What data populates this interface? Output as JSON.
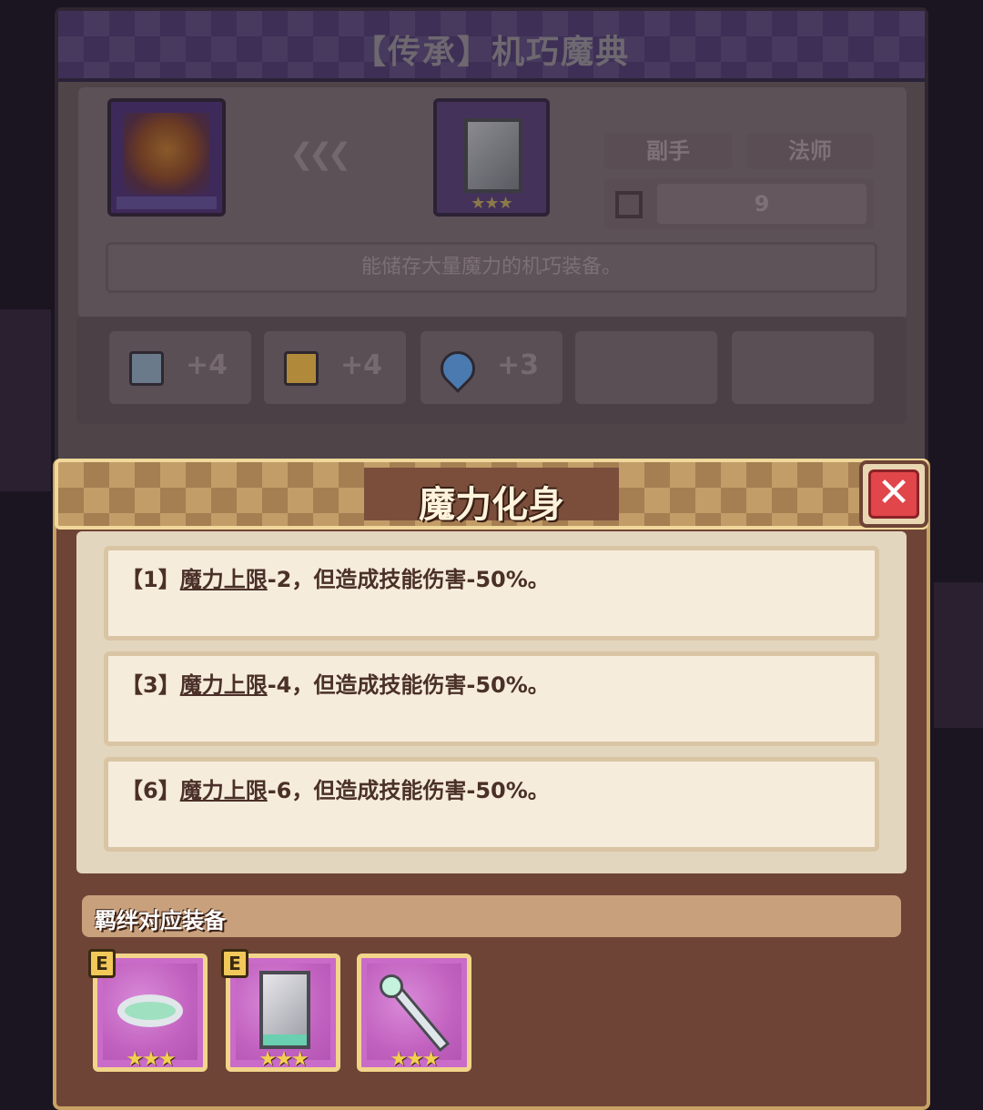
{
  "item_panel": {
    "title": "【传承】机巧魔典",
    "tag_slot": "副手",
    "tag_class": "法师",
    "level": "9",
    "description": "能储存大量魔力的机巧装备。",
    "item_stars": "★★★",
    "stats": [
      {
        "icon": "book-icon",
        "value": "+4"
      },
      {
        "icon": "boot-icon",
        "value": "+4"
      },
      {
        "icon": "mana-drop-icon",
        "value": "+3"
      }
    ]
  },
  "bond_panel": {
    "title": "魔力化身",
    "close_label": "✕",
    "effects": [
      {
        "prefix": "【1】",
        "keyword": "魔力上限",
        "suffix": "-2，但造成技能伤害-50%。"
      },
      {
        "prefix": "【3】",
        "keyword": "魔力上限",
        "suffix": "-4，但造成技能伤害-50%。"
      },
      {
        "prefix": "【6】",
        "keyword": "魔力上限",
        "suffix": "-6，但造成技能伤害-50%。"
      }
    ],
    "section_label": "羁绊对应装备",
    "equipment": [
      {
        "icon": "ring-icon",
        "badge": "E",
        "stars": "★★★",
        "equipped": true
      },
      {
        "icon": "grimoire-icon",
        "badge": "E",
        "stars": "★★★",
        "equipped": true
      },
      {
        "icon": "wand-icon",
        "badge": "",
        "stars": "★★★",
        "equipped": false
      }
    ]
  },
  "colors": {
    "panel_brown": "#6e4436",
    "gold_border": "#c7a264",
    "close_red": "#e0464a",
    "equip_purple": "#c96bc8",
    "star_gold": "#f4d050"
  }
}
